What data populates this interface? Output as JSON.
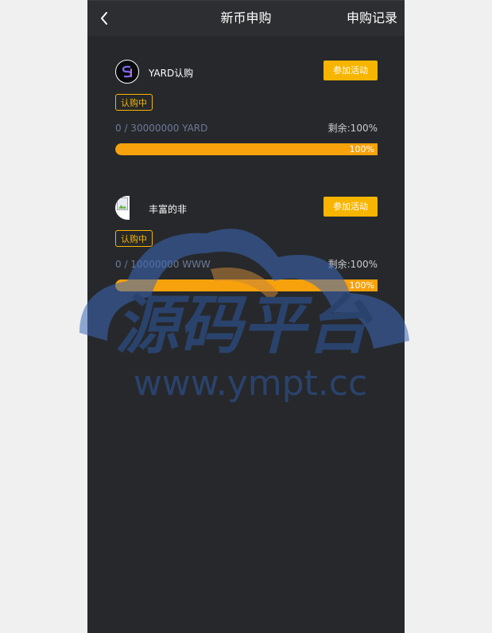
{
  "header": {
    "title": "新币申购",
    "record_link": "申购记录"
  },
  "colors": {
    "background": "#26282b",
    "accent": "#f7b500",
    "progress": "#f7a10c",
    "muted_text": "#6b7a99"
  },
  "offerings": [
    {
      "name": "YARD认购",
      "icon": "yard-logo-icon",
      "join_label": "参加活动",
      "status": "认购中",
      "amount": "0 / 30000000 YARD",
      "remaining": "剩余:100%",
      "progress_percent": 100,
      "progress_label": "100%"
    },
    {
      "name": "丰富的非",
      "icon": "broken-image-icon",
      "join_label": "参加活动",
      "status": "认购中",
      "amount": "0 / 10000000 WWW",
      "remaining": "剩余:100%",
      "progress_percent": 100,
      "progress_label": "100%"
    }
  ],
  "watermark": {
    "title": "源码平台",
    "url": "www.ympt.cc"
  }
}
